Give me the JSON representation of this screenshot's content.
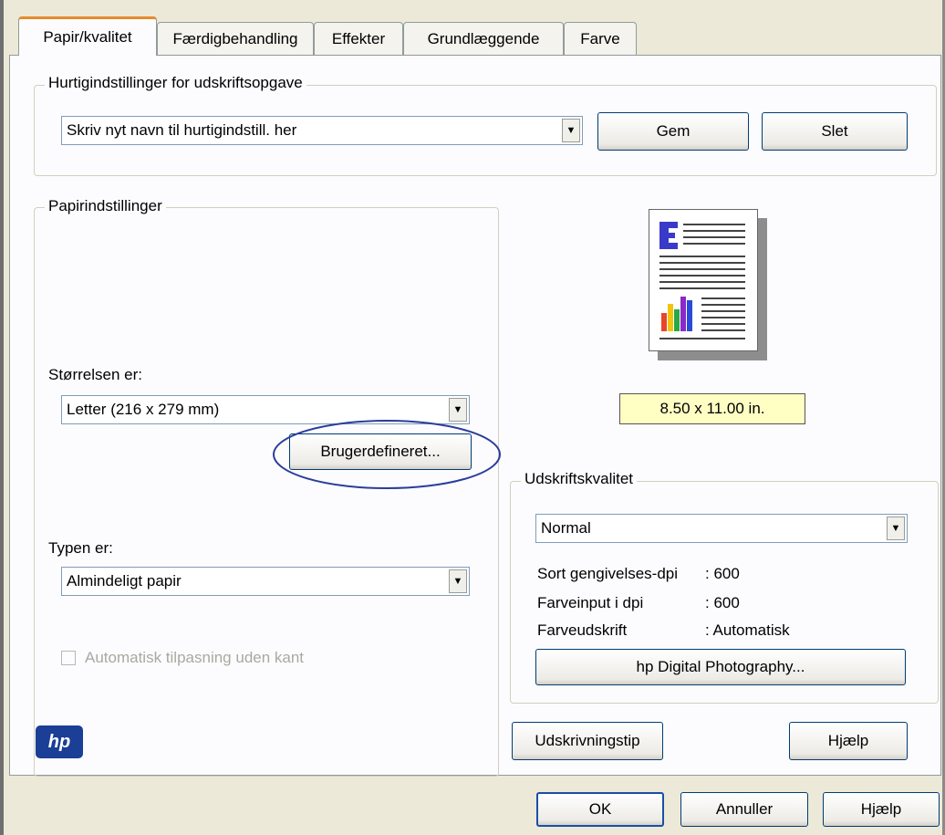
{
  "tabs": [
    {
      "label": "Papir/kvalitet",
      "active": true
    },
    {
      "label": "Færdigbehandling",
      "active": false
    },
    {
      "label": "Effekter",
      "active": false
    },
    {
      "label": "Grundlæggende",
      "active": false
    },
    {
      "label": "Farve",
      "active": false
    }
  ],
  "quick_settings": {
    "title": "Hurtigindstillinger for udskriftsopgave",
    "combo_value": "Skriv nyt navn til hurtigindstill. her",
    "save_button": "Gem",
    "delete_button": "Slet"
  },
  "paper_settings": {
    "title": "Papirindstillinger",
    "size_label": "Størrelsen er:",
    "size_value": "Letter (216 x 279 mm)",
    "custom_button": "Brugerdefineret...",
    "type_label": "Typen er:",
    "type_value": "Almindeligt papir",
    "borderless_checkbox": "Automatisk tilpasning uden kant"
  },
  "preview": {
    "dimensions": "8.50 x 11.00 in."
  },
  "print_quality": {
    "title": "Udskriftskvalitet",
    "value": "Normal",
    "rows": [
      {
        "key": "Sort gengivelses-dpi",
        "value": ": 600"
      },
      {
        "key": "Farveinput i dpi",
        "value": ": 600"
      },
      {
        "key": "Farveudskrift",
        "value": ": Automatisk"
      }
    ],
    "photo_button": "hp Digital Photography..."
  },
  "footer": {
    "logo_text": "hp",
    "tips_button": "Udskrivningstip",
    "help_button": "Hjælp"
  },
  "dialog_buttons": {
    "ok": "OK",
    "cancel": "Annuller",
    "help": "Hjælp"
  },
  "colors": {
    "dialog_bg": "#ece9d8",
    "tab_page_bg": "#fcfcfe",
    "tab_active_accent": "#e68b2c",
    "preview_label_bg": "#ffffc4",
    "annotation_circle": "#2b3d99",
    "hp_logo_bg": "#1b3e96"
  }
}
